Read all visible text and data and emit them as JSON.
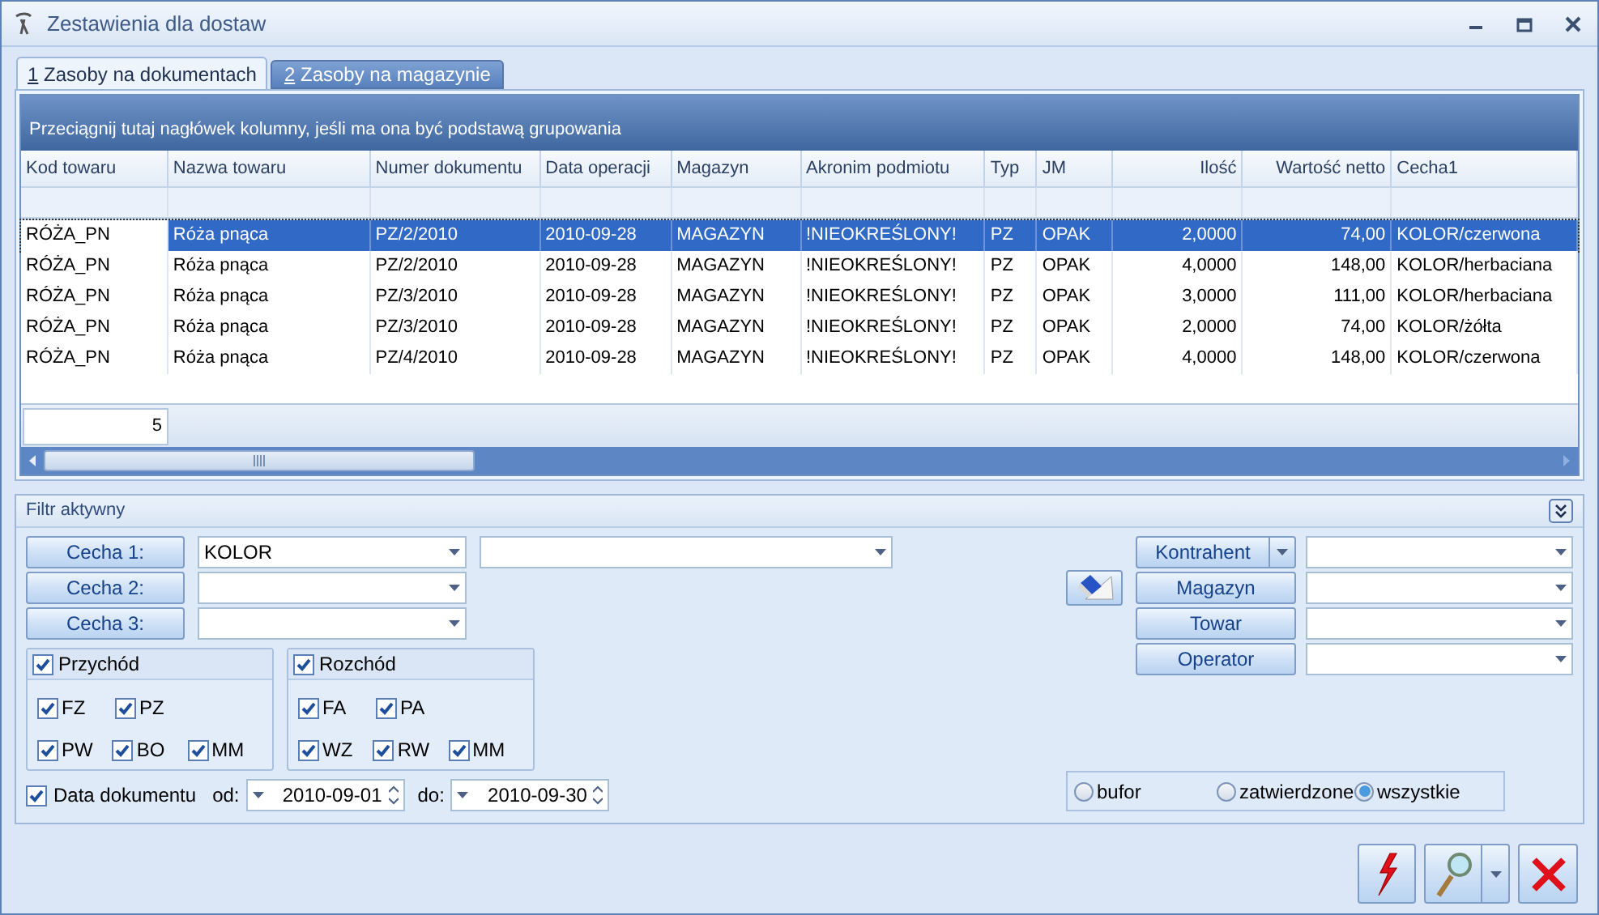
{
  "window": {
    "title": "Zestawienia dla dostaw"
  },
  "tabs": [
    {
      "key": "1",
      "label": "Zasoby na dokumentach",
      "selected": true
    },
    {
      "key": "2",
      "label": "Zasoby na magazynie",
      "selected": false
    }
  ],
  "grid": {
    "group_hint": "Przeciągnij tutaj nagłówek kolumny, jeśli ma ona być podstawą grupowania",
    "columns": [
      {
        "label": "Kod towaru",
        "kind": "text"
      },
      {
        "label": "Nazwa towaru",
        "kind": "text"
      },
      {
        "label": "Numer dokumentu",
        "kind": "text"
      },
      {
        "label": "Data operacji",
        "kind": "text"
      },
      {
        "label": "Magazyn",
        "kind": "text"
      },
      {
        "label": "Akronim podmiotu",
        "kind": "text"
      },
      {
        "label": "Typ",
        "kind": "text"
      },
      {
        "label": "JM",
        "kind": "text"
      },
      {
        "label": "Ilość",
        "kind": "number"
      },
      {
        "label": "Wartość netto",
        "kind": "number"
      },
      {
        "label": "Cecha1",
        "kind": "text"
      }
    ],
    "rows": [
      {
        "selected": true,
        "focused": true,
        "cells": [
          "RÓŻA_PN",
          "Róża pnąca",
          "PZ/2/2010",
          "2010-09-28",
          "MAGAZYN",
          "!NIEOKREŚLONY!",
          "PZ",
          "OPAK",
          "2,0000",
          "74,00",
          "KOLOR/czerwona"
        ]
      },
      {
        "selected": false,
        "cells": [
          "RÓŻA_PN",
          "Róża pnąca",
          "PZ/2/2010",
          "2010-09-28",
          "MAGAZYN",
          "!NIEOKREŚLONY!",
          "PZ",
          "OPAK",
          "4,0000",
          "148,00",
          "KOLOR/herbaciana"
        ]
      },
      {
        "selected": false,
        "cells": [
          "RÓŻA_PN",
          "Róża pnąca",
          "PZ/3/2010",
          "2010-09-28",
          "MAGAZYN",
          "!NIEOKREŚLONY!",
          "PZ",
          "OPAK",
          "3,0000",
          "111,00",
          "KOLOR/herbaciana"
        ]
      },
      {
        "selected": false,
        "cells": [
          "RÓŻA_PN",
          "Róża pnąca",
          "PZ/3/2010",
          "2010-09-28",
          "MAGAZYN",
          "!NIEOKREŚLONY!",
          "PZ",
          "OPAK",
          "2,0000",
          "74,00",
          "KOLOR/żółta"
        ]
      },
      {
        "selected": false,
        "cells": [
          "RÓŻA_PN",
          "Róża pnąca",
          "PZ/4/2010",
          "2010-09-28",
          "MAGAZYN",
          "!NIEOKREŚLONY!",
          "PZ",
          "OPAK",
          "4,0000",
          "148,00",
          "KOLOR/czerwona"
        ]
      }
    ],
    "footer_count": "5"
  },
  "filter": {
    "title": "Filtr aktywny",
    "features": [
      {
        "label": "Cecha 1:",
        "value": "KOLOR"
      },
      {
        "label": "Cecha 2:"
      },
      {
        "label": "Cecha 3:"
      }
    ],
    "groups": [
      {
        "label": "Przychód",
        "checked": true,
        "rows": [
          [
            {
              "label": "FZ",
              "checked": true
            },
            {
              "label": "PZ",
              "checked": true
            }
          ],
          [
            {
              "label": "PW",
              "checked": true
            },
            {
              "label": "BO",
              "checked": true
            },
            {
              "label": "MM",
              "checked": true
            }
          ]
        ]
      },
      {
        "label": "Rozchód",
        "checked": true,
        "rows": [
          [
            {
              "label": "FA",
              "checked": true
            },
            {
              "label": "PA",
              "checked": true
            }
          ],
          [
            {
              "label": "WZ",
              "checked": true
            },
            {
              "label": "RW",
              "checked": true
            },
            {
              "label": "MM",
              "checked": true
            }
          ]
        ]
      }
    ],
    "date": {
      "label": "Data dokumentu",
      "checked": true,
      "from_label": "od:",
      "from": "2010-09-01",
      "to_label": "do:",
      "to": "2010-09-30"
    },
    "pickers": [
      {
        "label": "Kontrahent",
        "kind": "split"
      },
      {
        "label": "Magazyn",
        "kind": "plain"
      },
      {
        "label": "Towar",
        "kind": "plain"
      },
      {
        "label": "Operator",
        "kind": "plain"
      }
    ],
    "status": [
      {
        "label": "bufor",
        "selected": false
      },
      {
        "label": "zatwierdzone",
        "selected": false
      },
      {
        "label": "wszystkie",
        "selected": true
      }
    ]
  }
}
